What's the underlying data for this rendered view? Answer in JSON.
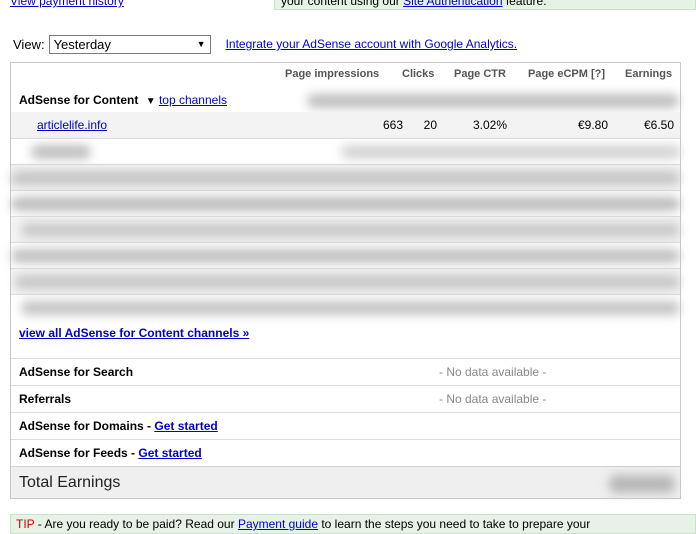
{
  "top": {
    "payment_history_link": "View payment history",
    "notice_text": "your content using our",
    "notice_link": "Site Authentication",
    "notice_suffix": "feature."
  },
  "view": {
    "label": "View:",
    "selected": "Yesterday",
    "ga_link": "Integrate your AdSense account with Google Analytics."
  },
  "table": {
    "columns": [
      "Page impressions",
      "Clicks",
      "Page CTR",
      "Page eCPM [?]",
      "Earnings"
    ],
    "content_section": {
      "title": "AdSense for Content",
      "channels_link": "top channels",
      "rows": [
        {
          "site": "articlelife.info",
          "impressions": "663",
          "clicks": "20",
          "ctr": "3.02%",
          "ecpm": "€9.80",
          "earnings": "€6.50"
        }
      ],
      "view_all_link": "view all AdSense for Content channels »"
    },
    "search": {
      "title": "AdSense for Search",
      "status": "- No data available -"
    },
    "referrals": {
      "title": "Referrals",
      "status": "- No data available -"
    },
    "domains": {
      "title": "AdSense for Domains",
      "link": "Get started"
    },
    "feeds": {
      "title": "AdSense for Feeds",
      "link": "Get started"
    },
    "total_label": "Total Earnings"
  },
  "tip": {
    "label": "TIP",
    "text_1": "- Are you ready to be paid? Read our",
    "link": "Payment guide",
    "text_2": "to learn the steps you need to take to prepare your"
  },
  "colors": {
    "link": "#0000cc",
    "tip_bg": "#e5f2e5",
    "total_bg": "#efefef"
  }
}
